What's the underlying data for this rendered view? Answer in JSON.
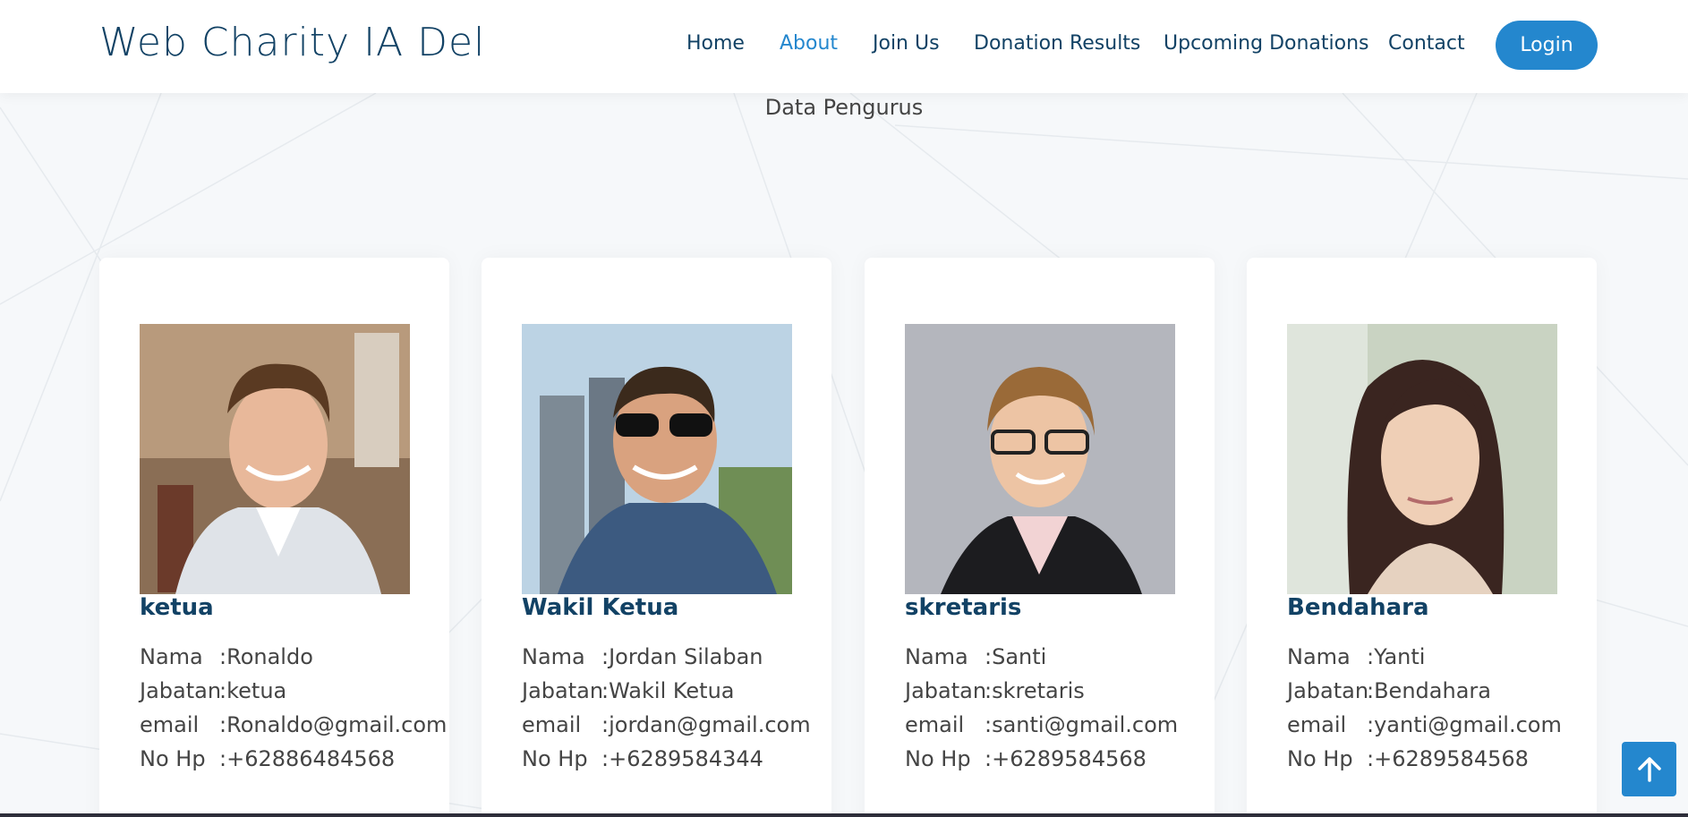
{
  "header": {
    "brand": "Web Charity IA Del",
    "nav": [
      {
        "label": "Home",
        "active": false
      },
      {
        "label": "About",
        "active": true
      },
      {
        "label": "Join Us",
        "active": false
      },
      {
        "label": "Donation Results",
        "active": false
      },
      {
        "label": "Upcoming Donations",
        "active": false
      },
      {
        "label": "Contact",
        "active": false
      }
    ],
    "login_label": "Login"
  },
  "section": {
    "title": "Data Pengurus"
  },
  "labels": {
    "nama": "Nama",
    "jabatan": "Jabatan",
    "email": "email",
    "nohp": "No Hp",
    "sep": ":"
  },
  "members": [
    {
      "title": "ketua",
      "nama": "Ronaldo",
      "jabatan": "ketua",
      "email": "Ronaldo@gmail.com",
      "nohp": "+62886484568"
    },
    {
      "title": "Wakil Ketua",
      "nama": "Jordan Silaban",
      "jabatan": "Wakil Ketua",
      "email": "jordan@gmail.com",
      "nohp": "+6289584344"
    },
    {
      "title": "skretaris",
      "nama": "Santi",
      "jabatan": "skretaris",
      "email": "santi@gmail.com",
      "nohp": "+6289584568"
    },
    {
      "title": "Bendahara",
      "nama": "Yanti",
      "jabatan": "Bendahara",
      "email": "yanti@gmail.com",
      "nohp": "+6289584568"
    }
  ],
  "colors": {
    "accent": "#2487ce",
    "brand": "#124265",
    "text": "#444444"
  },
  "icons": {
    "scroll_top": "arrow-up-icon"
  }
}
